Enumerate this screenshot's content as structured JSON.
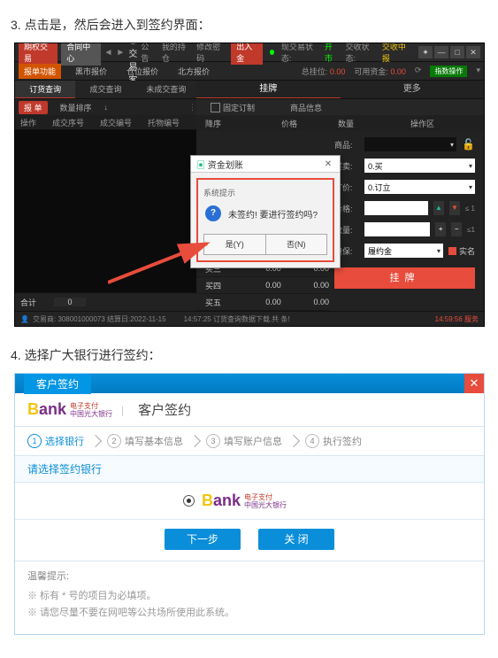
{
  "doc": {
    "heading_3": "3. 点击是，然后会进入到签约界面：",
    "heading_4": "4. 选择广大银行进行签约："
  },
  "app": {
    "titlebar": {
      "tab1": "期权交易",
      "tab2": "合同中心",
      "title": "北方生态交易客户端",
      "links": [
        "公告",
        "我的持仓",
        "修改密码"
      ],
      "deposit_btn": "出入金",
      "market_status_label": "现交易状态:",
      "market_status_value": "开市",
      "close_status_label": "交收状态:",
      "close_status_value": "交收中报"
    },
    "toolbar": {
      "tab1": "报单功能",
      "tab2": "黑市报价",
      "tab3": "仓位报价",
      "tab4": "北方报价",
      "sum_lots_label": "总挂位:",
      "sum_lots_value": "0.00",
      "margin_label": "可用资金:",
      "margin_value": "0.00",
      "tag": "指数操作"
    },
    "left": {
      "tabs": [
        "订货查询",
        "成交查询",
        "未成交查询"
      ],
      "sub_btn": "报 单",
      "sub_items": [
        "数量排序",
        "↓"
      ],
      "head": [
        "操作",
        "成交序号",
        "成交编号",
        "托物编号"
      ],
      "foot_label": "合计",
      "foot_value": "0"
    },
    "right": {
      "tab_list": "挂牌",
      "tab_more": "更多",
      "sub_check": "固定订制",
      "sub_link": "商品信息",
      "cols": [
        "降序",
        "价格",
        "数量",
        "操作区"
      ],
      "rows": [
        {
          "name": "买三",
          "price": "0.00",
          "qty": "0.00"
        },
        {
          "name": "买四",
          "price": "0.00",
          "qty": "0.00"
        },
        {
          "name": "买五",
          "price": "0.00",
          "qty": "0.00"
        }
      ]
    },
    "form": {
      "prod_label": "商品:",
      "prod_value": "",
      "side_label": "买卖:",
      "side_value": "0.买",
      "type_label": "订价:",
      "type_value": "0.订立",
      "price_label": "价格:",
      "price_value": "",
      "price_hint": "≤ 1",
      "qty_label": "数量:",
      "qty_value": "",
      "qty_hint": "≤1",
      "fee_label": "担保:",
      "fee_value": "履约金",
      "realname": "实名",
      "submit": "挂牌"
    },
    "statusbar": {
      "user": "交易商: 308001000073 结算日:2022-11-15",
      "time": "14:57:25 订货查询数据下载.共 条!",
      "right": "14:59:56 服务"
    },
    "dialog": {
      "win_title": "资金划账",
      "inner_title": "系统提示",
      "message": "未签约! 要进行签约吗?",
      "btn_yes": "是(Y)",
      "btn_no": "否(N)"
    }
  },
  "bank": {
    "top_tab": "客户签约",
    "header_title": "客户签约",
    "logo_sub1": "电子支付",
    "logo_sub2": "中国光大银行",
    "steps": [
      "选择银行",
      "填写基本信息",
      "填写账户信息",
      "执行签约"
    ],
    "choose_label": "请选择签约银行",
    "choice_sub1": "电子支付",
    "choice_sub2": "中国光大银行",
    "btn_next": "下一步",
    "btn_close": "关 闭",
    "hints_title": "温馨提示:",
    "hints": [
      "※ 标有 * 号的项目为必填项。",
      "※ 请您尽量不要在网吧等公共场所使用此系统。"
    ]
  }
}
